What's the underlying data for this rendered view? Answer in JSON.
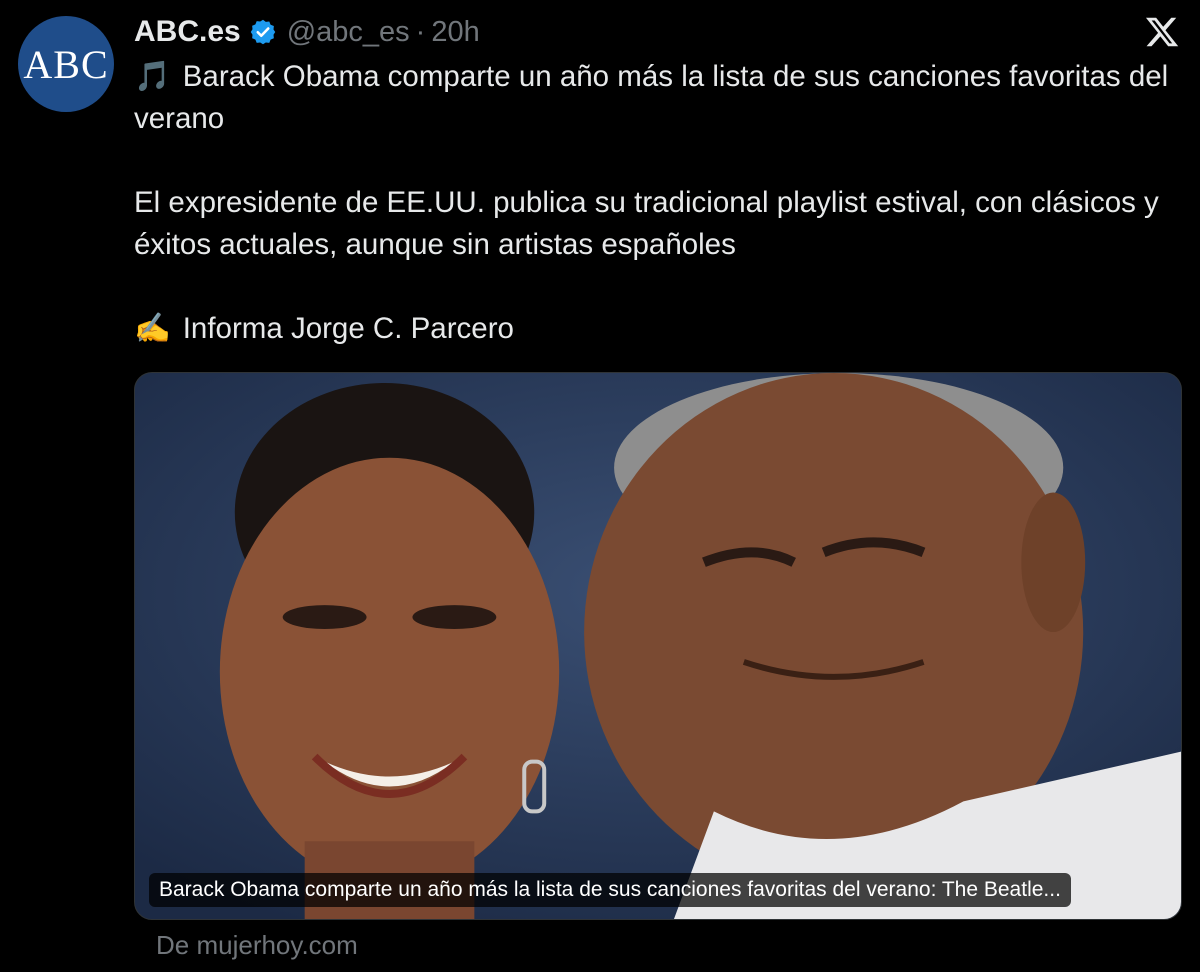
{
  "author": {
    "avatar_text": "ABC",
    "display_name": "ABC.es",
    "handle": "@abc_es",
    "separator": "·",
    "time": "20h"
  },
  "tweet": {
    "line1_emoji": "🎵",
    "line1_text": "Barack Obama comparte un año más la lista de sus canciones favoritas del verano",
    "line2_text": "El expresidente de EE.UU. publica su tradicional playlist estival, con clásicos y éxitos actuales, aunque sin artistas españoles",
    "line3_emoji": "✍️",
    "line3_text": "Informa Jorge C. Parcero"
  },
  "card": {
    "caption": "Barack Obama comparte un año más la lista de sus canciones favoritas del verano: The Beatle...",
    "source": "De mujerhoy.com"
  },
  "icons": {
    "verified": "verified-badge-icon",
    "x_logo": "x-logo-icon",
    "music": "music-note-emoji",
    "writing": "writing-hand-emoji"
  },
  "colors": {
    "background": "#000000",
    "text": "#e7e9ea",
    "secondary_text": "#71767b",
    "verified_blue": "#1d9bf0",
    "avatar_blue": "#1f4d8a"
  }
}
